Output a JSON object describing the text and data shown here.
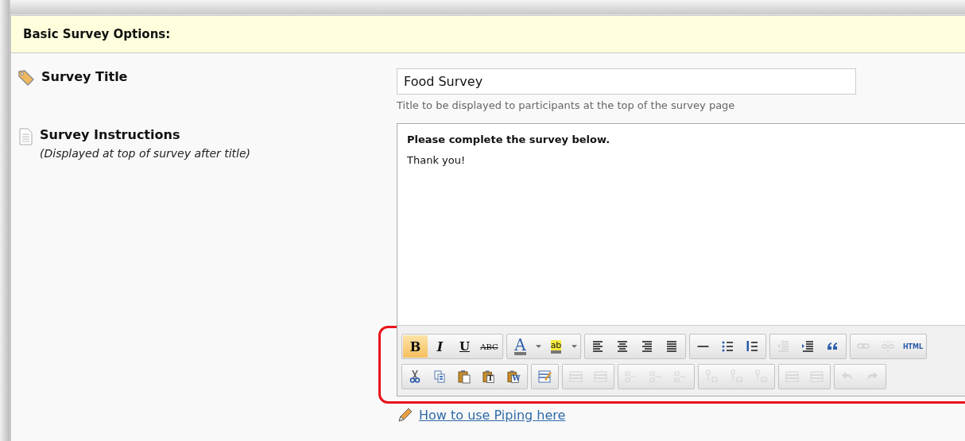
{
  "section": {
    "title": "Basic Survey Options:"
  },
  "fields": [
    {
      "kind": "text",
      "label": "Survey Title",
      "value": "Food Survey",
      "hint": "Title to be displayed to participants at the top of the survey page"
    },
    {
      "kind": "editor",
      "label": "Survey Instructions",
      "note": "(Displayed at top of survey after title)",
      "paragraphs": [
        {
          "text": "Please complete the survey below.",
          "bold": true
        },
        {
          "text": "Thank you!",
          "bold": false
        }
      ]
    }
  ],
  "toolbar": {
    "highlighted": true,
    "rows": [
      {
        "groups": [
          {
            "buttons": [
              {
                "kind": "bold",
                "label": "B",
                "selected": true,
                "disabled": false
              },
              {
                "kind": "italic",
                "label": "I",
                "selected": false,
                "disabled": false
              },
              {
                "kind": "underline",
                "label": "U",
                "selected": false,
                "disabled": false
              },
              {
                "kind": "strike",
                "label": "ABC",
                "selected": false,
                "disabled": false
              }
            ]
          },
          {
            "buttons": [
              {
                "kind": "font-color",
                "label": "A",
                "selected": false,
                "disabled": false
              },
              {
                "kind": "dropdown",
                "selected": false,
                "disabled": false
              },
              {
                "kind": "highlight",
                "label": "ab",
                "selected": false,
                "disabled": false
              },
              {
                "kind": "dropdown",
                "selected": false,
                "disabled": false
              }
            ]
          },
          {
            "buttons": [
              {
                "kind": "align-left",
                "selected": false,
                "disabled": false
              },
              {
                "kind": "align-center",
                "selected": false,
                "disabled": false
              },
              {
                "kind": "align-right",
                "selected": false,
                "disabled": false
              },
              {
                "kind": "justify",
                "selected": false,
                "disabled": false
              }
            ]
          },
          {
            "buttons": [
              {
                "kind": "rule",
                "selected": false,
                "disabled": false
              },
              {
                "kind": "bullets",
                "selected": false,
                "disabled": false
              },
              {
                "kind": "numbers",
                "selected": false,
                "disabled": false
              }
            ]
          },
          {
            "buttons": [
              {
                "kind": "outdent",
                "selected": false,
                "disabled": true
              },
              {
                "kind": "indent",
                "selected": false,
                "disabled": false
              },
              {
                "kind": "quote",
                "selected": false,
                "disabled": false
              }
            ]
          },
          {
            "buttons": [
              {
                "kind": "link",
                "selected": false,
                "disabled": true
              },
              {
                "kind": "unlink",
                "selected": false,
                "disabled": true
              },
              {
                "kind": "html",
                "label": "HTML",
                "selected": false,
                "disabled": false
              }
            ]
          }
        ]
      },
      {
        "groups": [
          {
            "buttons": [
              {
                "kind": "cut",
                "selected": false,
                "disabled": false
              },
              {
                "kind": "copy",
                "selected": false,
                "disabled": false
              },
              {
                "kind": "paste",
                "selected": false,
                "disabled": false
              },
              {
                "kind": "paste-text",
                "label": "T",
                "selected": false,
                "disabled": false
              },
              {
                "kind": "paste-word",
                "label": "W",
                "selected": false,
                "disabled": false
              }
            ]
          },
          {
            "buttons": [
              {
                "kind": "table-edit",
                "selected": false,
                "disabled": false
              }
            ]
          },
          {
            "buttons": [
              {
                "kind": "table",
                "selected": false,
                "disabled": true
              },
              {
                "kind": "table",
                "selected": false,
                "disabled": true
              }
            ]
          },
          {
            "buttons": [
              {
                "kind": "rows",
                "selected": false,
                "disabled": true
              },
              {
                "kind": "rows",
                "selected": false,
                "disabled": true
              },
              {
                "kind": "rows",
                "selected": false,
                "disabled": true
              }
            ]
          },
          {
            "buttons": [
              {
                "kind": "cols",
                "selected": false,
                "disabled": true
              },
              {
                "kind": "cols",
                "selected": false,
                "disabled": true
              },
              {
                "kind": "cols",
                "selected": false,
                "disabled": true
              }
            ]
          },
          {
            "buttons": [
              {
                "kind": "table",
                "selected": false,
                "disabled": true
              },
              {
                "kind": "table",
                "selected": false,
                "disabled": true
              }
            ]
          },
          {
            "buttons": [
              {
                "kind": "undo",
                "selected": false,
                "disabled": true
              },
              {
                "kind": "redo",
                "selected": false,
                "disabled": true
              }
            ]
          }
        ]
      }
    ]
  },
  "link": {
    "text": "How to use Piping here"
  }
}
